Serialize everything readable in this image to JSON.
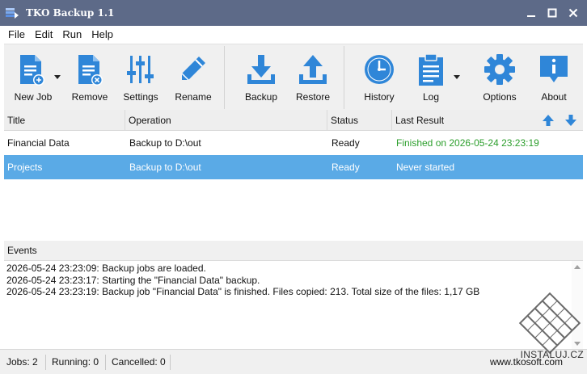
{
  "window": {
    "title": "TKO Backup 1.1",
    "controls": [
      "minimize-icon",
      "maximize-icon",
      "close-icon"
    ]
  },
  "menu": [
    "File",
    "Edit",
    "Run",
    "Help"
  ],
  "toolbar": {
    "new_job": "New Job",
    "remove": "Remove",
    "settings": "Settings",
    "rename": "Rename",
    "backup": "Backup",
    "restore": "Restore",
    "history": "History",
    "log": "Log",
    "options": "Options",
    "about": "About",
    "icon_color": "#2f86d8"
  },
  "jobs": {
    "columns": [
      "Title",
      "Operation",
      "Status",
      "Last Result"
    ],
    "rows": [
      {
        "title": "Financial Data",
        "operation": "Backup to D:\\out",
        "status": "Ready",
        "last_result": "Finished on 2026-05-24 23:23:19",
        "selected": false
      },
      {
        "title": "Projects",
        "operation": "Backup to D:\\out",
        "status": "Ready",
        "last_result": "Never started",
        "selected": true
      }
    ],
    "success_color": "#2b9e2b",
    "selection_color": "#5aaae6"
  },
  "events": {
    "title": "Events",
    "lines": [
      "2026-05-24 23:23:09: Backup jobs are loaded.",
      "2026-05-24 23:23:17: Starting the \"Financial Data\" backup.",
      "2026-05-24 23:23:19: Backup job \"Financial Data\" is finished. Files copied: 213. Total size of the files: 1,17 GB"
    ]
  },
  "status": {
    "jobs": "Jobs: 2",
    "running": "Running: 0",
    "cancelled": "Cancelled: 0",
    "url": "www.tkosoft.com"
  },
  "watermark": {
    "text": "INSTALUJ.CZ"
  }
}
